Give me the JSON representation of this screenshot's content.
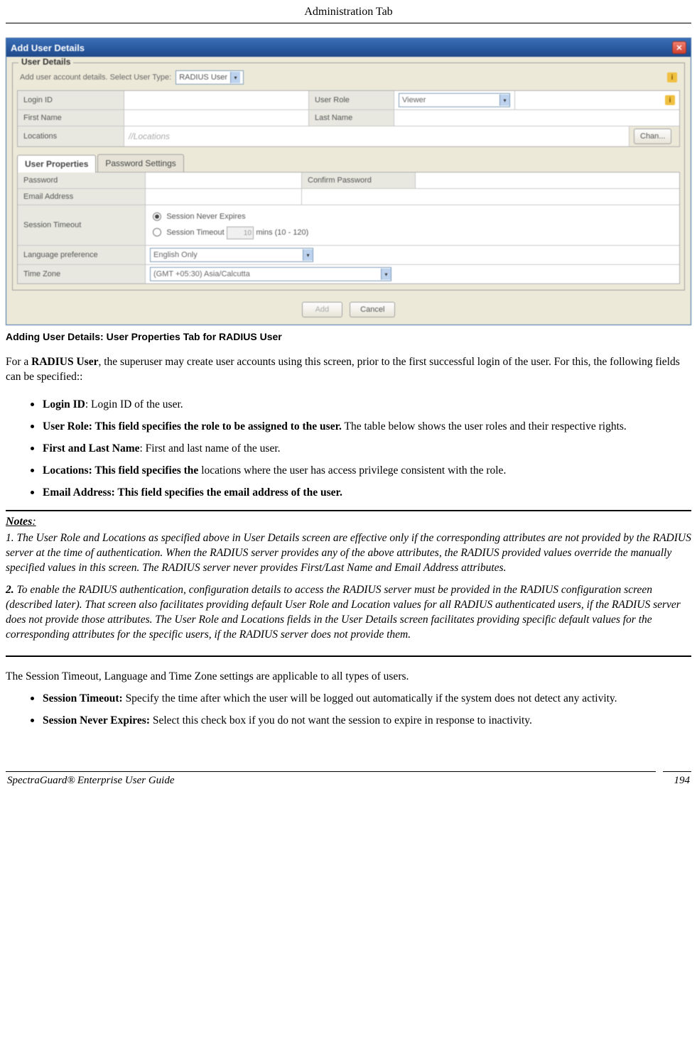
{
  "header": {
    "title": "Administration Tab"
  },
  "dialog": {
    "title": "Add User Details",
    "groupbox_title": "User Details",
    "instruction": "Add user account details.  Select User Type:",
    "user_type_value": "RADIUS User",
    "fields": {
      "login_id_label": "Login ID",
      "user_role_label": "User Role",
      "user_role_value": "Viewer",
      "first_name_label": "First Name",
      "last_name_label": "Last Name",
      "locations_label": "Locations",
      "locations_placeholder": "//Locations",
      "change_btn": "Chan..."
    },
    "tabs": {
      "user_properties": "User Properties",
      "password_settings": "Password Settings"
    },
    "props": {
      "password_label": "Password",
      "confirm_password_label": "Confirm Password",
      "email_label": "Email Address",
      "session_timeout_label": "Session Timeout",
      "never_expires": "Session Never Expires",
      "timeout_prefix": "Session Timeout",
      "timeout_value": "10",
      "timeout_suffix": "mins (10 - 120)",
      "language_label": "Language preference",
      "language_value": "English Only",
      "timezone_label": "Time Zone",
      "timezone_value": "(GMT +05:30)   Asia/Calcutta"
    },
    "buttons": {
      "add": "Add",
      "cancel": "Cancel"
    }
  },
  "caption": "Adding User Details: User Properties Tab for RADIUS User",
  "intro": {
    "prefix": "For a ",
    "bold": "RADIUS User",
    "suffix": ", the superuser may create user accounts using this screen, prior to the first successful login of the user. For this, the following fields can be specified::"
  },
  "bullets1": [
    {
      "bold": "Login ID",
      "text": ": Login ID of the user."
    },
    {
      "bold": "User Role: This field specifies the role to be assigned to the user.",
      "text": " The table below shows the user roles and their respective rights."
    },
    {
      "bold": "First and Last Name",
      "text": ": First and last name of the user."
    },
    {
      "bold": "Locations: This field specifies the",
      "text": " locations where the user has access privilege consistent with the role."
    },
    {
      "bold": "Email Address: This field specifies the email address of the user.",
      "text": ""
    }
  ],
  "notes": {
    "title": "Notes",
    "p1": "1. The User Role and Locations as specified above in User Details screen are effective only if the corresponding attributes are not provided by the RADIUS server at the time of authentication. When the RADIUS server provides any of the above attributes, the RADIUS provided values override the manually specified values in this screen. The RADIUS server never provides First/Last Name and Email Address attributes.",
    "p2_bold": "2.",
    "p2": " To enable the RADIUS authentication, configuration details to access the RADIUS server must be provided in the RADIUS configuration screen (described later). That screen also facilitates providing default User Role and Location values for all RADIUS authenticated users, if the RADIUS server does not provide those attributes. The User Role and Locations fields  in the User Details screen facilitates providing specific default values for the corresponding attributes for the specific users, if the RADIUS server does not provide them."
  },
  "after_notes": "The Session Timeout, Language and Time Zone settings are applicable to all types of users.",
  "bullets2": [
    {
      "bold": "Session Timeout:",
      "text": " Specify the time after which the user will be logged out automatically if the system does not detect any activity."
    },
    {
      "bold": "Session Never Expires:",
      "text": " Select this check box if you do not want the session to expire in response to inactivity."
    }
  ],
  "footer": {
    "left": "SpectraGuard® Enterprise User Guide",
    "right": "194"
  }
}
